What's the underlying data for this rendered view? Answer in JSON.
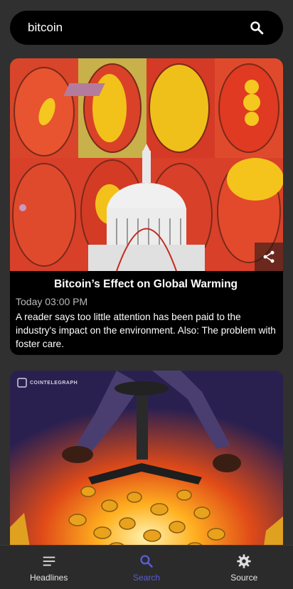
{
  "search": {
    "value": "bitcoin"
  },
  "articles": [
    {
      "title": "Bitcoin’s Effect on Global Warming",
      "time": "Today 03:00 PM",
      "description": "A reader says too little attention has been paid to the industry's impact on the environment. Also: The problem with foster care."
    },
    {
      "source_logo_text": "COINTELEGRAPH"
    }
  ],
  "nav": {
    "items": [
      {
        "label": "Headlines",
        "icon": "headlines-icon",
        "active": false
      },
      {
        "label": "Search",
        "icon": "search-icon",
        "active": true
      },
      {
        "label": "Source",
        "icon": "gear-icon",
        "active": false
      }
    ]
  },
  "colors": {
    "background": "#303030",
    "card": "#000000",
    "active_nav": "#5c5cd6"
  }
}
